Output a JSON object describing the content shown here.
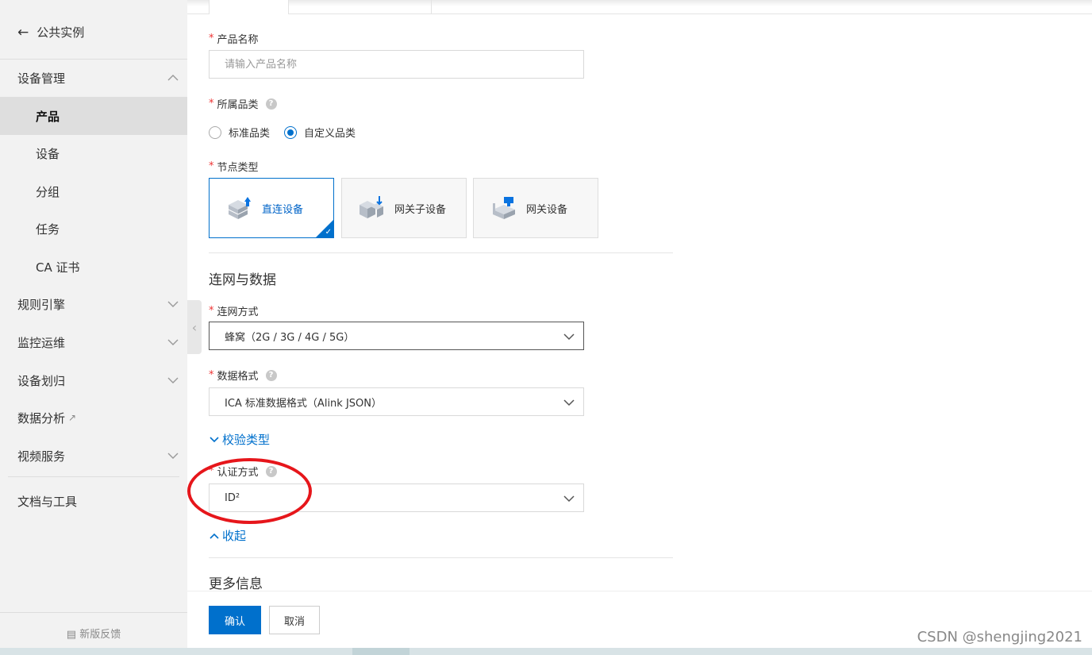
{
  "sidebar": {
    "back_label": "公共实例",
    "items": [
      {
        "label": "设备管理"
      },
      {
        "label": "产品"
      },
      {
        "label": "设备"
      },
      {
        "label": "分组"
      },
      {
        "label": "任务"
      },
      {
        "label": "CA 证书"
      },
      {
        "label": "规则引擎"
      },
      {
        "label": "监控运维"
      },
      {
        "label": "设备划归"
      },
      {
        "label": "数据分析"
      },
      {
        "label": "视频服务"
      },
      {
        "label": "文档与工具"
      }
    ],
    "feedback_label": "新版反馈",
    "external_icon": "external-link-icon"
  },
  "form": {
    "product_name": {
      "label": "产品名称",
      "placeholder": "请输入产品名称",
      "value": ""
    },
    "category": {
      "label": "所属品类",
      "options": [
        "标准品类",
        "自定义品类"
      ],
      "selected": "自定义品类"
    },
    "node_type": {
      "label": "节点类型",
      "options": [
        "直连设备",
        "网关子设备",
        "网关设备"
      ],
      "selected": "直连设备"
    },
    "network_section_title": "连网与数据",
    "network": {
      "label": "连网方式",
      "value": "蜂窝（2G / 3G / 4G / 5G）"
    },
    "data_format": {
      "label": "数据格式",
      "value": "ICA 标准数据格式（Alink JSON）"
    },
    "verify_toggle": "校验类型",
    "auth": {
      "label": "认证方式",
      "value": "ID²"
    },
    "collapse_toggle": "收起",
    "more_section_title": "更多信息",
    "required_mark": "*",
    "help_mark": "?"
  },
  "footer": {
    "confirm": "确认",
    "cancel": "取消"
  },
  "watermark": "CSDN @shengjing2021",
  "colors": {
    "accent": "#0070cc",
    "brand_orange": "#ff6a00",
    "annotation_red": "#e6161b"
  }
}
